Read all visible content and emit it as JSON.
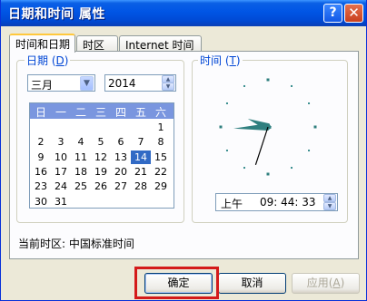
{
  "window": {
    "title": "日期和时间 属性",
    "help_label": "?",
    "close_label": "✕"
  },
  "tabs": [
    {
      "label": "时间和日期"
    },
    {
      "label": "时区"
    },
    {
      "label": "Internet 时间"
    }
  ],
  "date_group": {
    "label": "日期",
    "hotkey": "D",
    "month": "三月",
    "year": "2014"
  },
  "calendar": {
    "weekdays": [
      "日",
      "一",
      "二",
      "三",
      "四",
      "五",
      "六"
    ],
    "weeks": [
      [
        "",
        "",
        "",
        "",
        "",
        "",
        "1"
      ],
      [
        "2",
        "3",
        "4",
        "5",
        "6",
        "7",
        "8"
      ],
      [
        "9",
        "10",
        "11",
        "12",
        "13",
        "14",
        "15"
      ],
      [
        "16",
        "17",
        "18",
        "19",
        "20",
        "21",
        "22"
      ],
      [
        "23",
        "24",
        "25",
        "26",
        "27",
        "28",
        "29"
      ],
      [
        "30",
        "31",
        "",
        "",
        "",
        "",
        ""
      ]
    ],
    "selected_day": "14",
    "colors": {
      "header": "#7a96df",
      "selected": "#316ac5"
    }
  },
  "time_group": {
    "label": "时间",
    "hotkey": "T",
    "ampm": "上午",
    "time": "09: 44: 33"
  },
  "clock": {
    "hour": 9,
    "minute": 44,
    "second": 33,
    "hand_color": "#2f7f7f",
    "second_hand_color": "#000000"
  },
  "timezone": {
    "text": "当前时区: 中国标准时间"
  },
  "buttons": {
    "ok": "确定",
    "cancel": "取消",
    "apply": "应用",
    "apply_hotkey": "A"
  }
}
